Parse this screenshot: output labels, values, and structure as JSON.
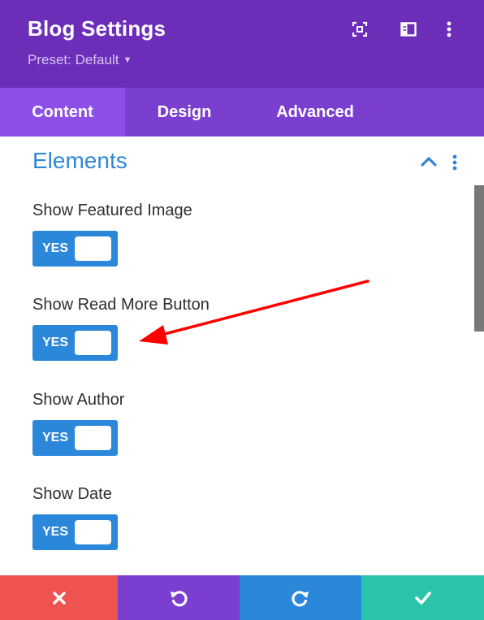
{
  "header": {
    "title": "Blog Settings",
    "preset_label": "Preset: Default",
    "icons": [
      "focus-icon",
      "sidebar-layout-icon",
      "more-vertical-icon"
    ]
  },
  "tabs": [
    {
      "label": "Content",
      "active": true
    },
    {
      "label": "Design",
      "active": false
    },
    {
      "label": "Advanced",
      "active": false
    }
  ],
  "section": {
    "title": "Elements",
    "expanded": true
  },
  "fields": [
    {
      "label": "Show Featured Image",
      "toggle": "YES"
    },
    {
      "label": "Show Read More Button",
      "toggle": "YES"
    },
    {
      "label": "Show Author",
      "toggle": "YES"
    },
    {
      "label": "Show Date",
      "toggle": "YES"
    }
  ],
  "footer": {
    "buttons": [
      "close-icon",
      "undo-icon",
      "redo-icon",
      "check-icon"
    ]
  },
  "colors": {
    "header": "#6c2eb9",
    "tabs": "#7b3fd0",
    "active_tab": "#8d4fe8",
    "section_title": "#2f87d6",
    "toggle": "#2b87da",
    "annotation_arrow": "#ff0000",
    "footer_close": "#ef5350",
    "footer_undo": "#7a3fd0",
    "footer_redo": "#2b87da",
    "footer_save": "#29c4a9"
  }
}
